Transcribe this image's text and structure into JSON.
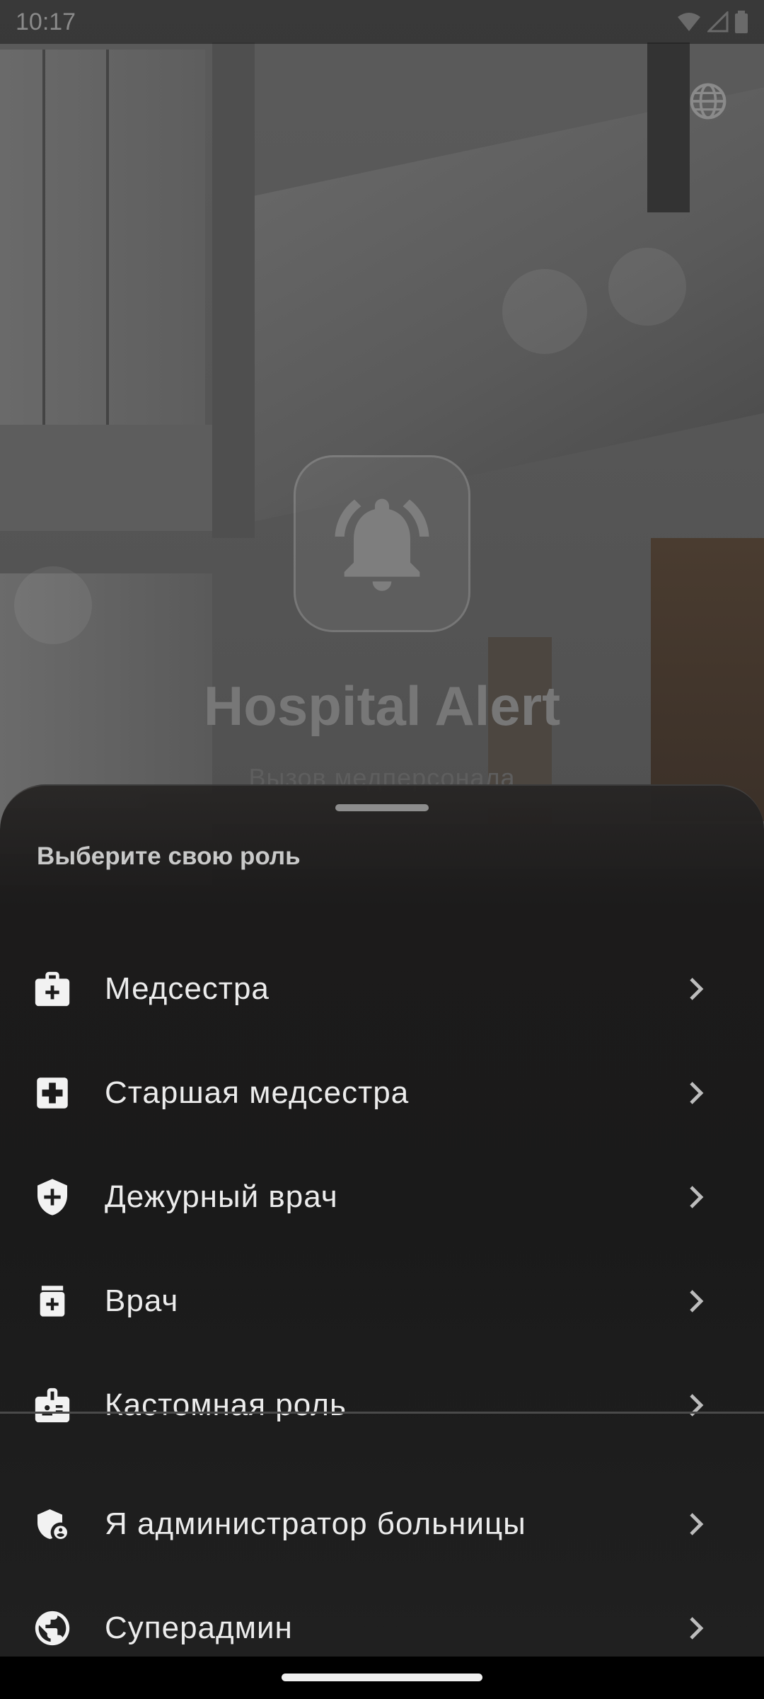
{
  "status_bar": {
    "time": "10:17",
    "icons": [
      "wifi-icon",
      "signal-icon",
      "battery-icon"
    ]
  },
  "header": {
    "language_icon": "globe-icon"
  },
  "app": {
    "logo_icon": "bell-ringing-icon",
    "title": "Hospital Alert",
    "subtitle": "Вызов медперсонала"
  },
  "sheet": {
    "title": "Выберите свою роль",
    "roles": [
      {
        "label": "Медсестра",
        "icon": "medical-bag-icon"
      },
      {
        "label": "Старшая медсестра",
        "icon": "medical-cross-box-icon"
      },
      {
        "label": "Дежурный врач",
        "icon": "shield-plus-icon"
      },
      {
        "label": "Врач",
        "icon": "medication-icon"
      },
      {
        "label": "Кастомная роль",
        "icon": "badge-icon"
      }
    ],
    "admin_items": [
      {
        "label": "Я администратор больницы",
        "icon": "admin-shield-icon"
      },
      {
        "label": "Суперадмин",
        "icon": "globe-icon"
      }
    ]
  },
  "colors": {
    "sheet_background": "#1c1b1b",
    "text_primary": "#ececec",
    "text_secondary": "#c9c9c9"
  }
}
